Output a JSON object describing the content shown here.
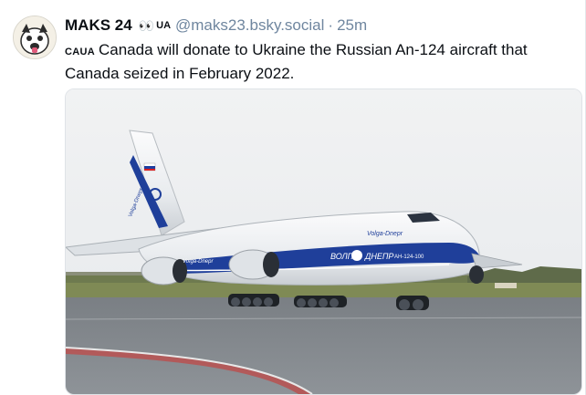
{
  "post": {
    "author_name": "MAKS 24",
    "author_emoji": "👀",
    "author_flag": "UA",
    "handle": "@maks23.bsky.social",
    "separator": "·",
    "time": "25m",
    "text_prefix": "CAUA",
    "text": "Canada will donate to Ukraine the Russian An-124 aircraft that Canada seized in February 2022."
  },
  "image": {
    "livery_tail": "Volga-Dnepr",
    "livery_nose": "Volga-Dnepr",
    "livery_engine": "Volga-Dnepr",
    "livery_belly_left": "ВОЛГА",
    "livery_belly_right": "ДНЕПР",
    "registration": "AH-124-100"
  },
  "colors": {
    "handle": "#6f869f",
    "livery_blue": "#1f3f9a",
    "sky": "#eceff2"
  }
}
